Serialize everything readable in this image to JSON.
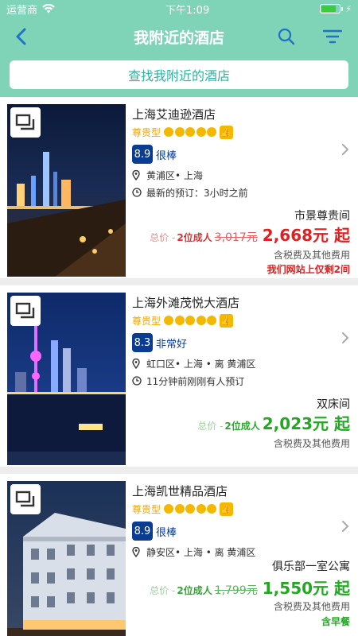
{
  "status": {
    "carrier": "运营商",
    "time": "下午1:09"
  },
  "nav": {
    "title": "我附近的酒店"
  },
  "search": {
    "label": "查找我附近的酒店"
  },
  "colors": {
    "header_bg": "#7fd3b6",
    "accent_teal": "#2bb5a0",
    "score_blue": "#0a3d91",
    "price_red": "#e02020",
    "price_green": "#22a822",
    "star_gold": "#f5b800"
  },
  "hotels": [
    {
      "name": "上海艾迪逊酒店",
      "tier": "尊贵型",
      "score": "8.9",
      "score_label": "很棒",
      "location": "黄浦区• 上海",
      "time_info": "最新的预订：3小时之前",
      "room": "市景尊贵间",
      "total_label": "总价 - ",
      "adults": "2位成人",
      "old_price": "3,017元",
      "new_price": "2,668元 起",
      "tax": "含税费及其他费用",
      "extra": "我们网站上仅剩2间",
      "extra_color": "#e02020"
    },
    {
      "name": "上海外滩茂悦大酒店",
      "tier": "尊贵型",
      "score": "8.3",
      "score_label": "非常好",
      "location": "虹口区• 上海 • 离 黄浦区",
      "time_info": "11分钟前刚刚有人预订",
      "room": "双床间",
      "total_label": "总价 - ",
      "adults": "2位成人",
      "old_price": "",
      "new_price": "2,023元 起",
      "tax": "含税费及其他费用",
      "extra": ""
    },
    {
      "name": "上海凯世精品酒店",
      "tier": "尊贵型",
      "score": "8.9",
      "score_label": "很棒",
      "location": "静安区• 上海 • 离 黄浦区",
      "time_info": "",
      "room": "俱乐部一室公寓",
      "total_label": "总价 - ",
      "adults": "2位成人",
      "old_price": "1,799元",
      "new_price": "1,550元 起",
      "tax": "含税费及其他费用",
      "extra": "含早餐",
      "extra_color": "#22a822"
    }
  ]
}
